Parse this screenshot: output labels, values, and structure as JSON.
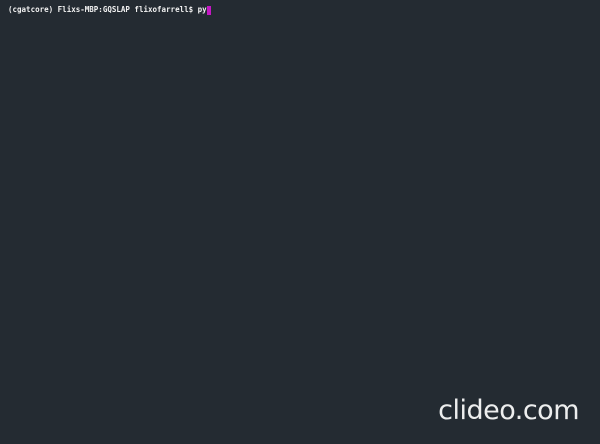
{
  "terminal": {
    "prompt": "(cgatcore) Flixs-MBP:GQSLAP flixofarrell$ ",
    "command": "py",
    "cursor_color": "#c417c4",
    "background_color": "#242b32"
  },
  "watermark": {
    "text": "clideo.com"
  }
}
